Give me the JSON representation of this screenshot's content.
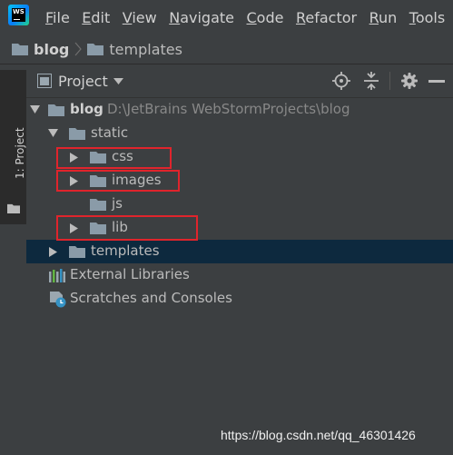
{
  "menu": {
    "items": [
      {
        "mnemonic": "F",
        "rest": "ile"
      },
      {
        "mnemonic": "E",
        "rest": "dit"
      },
      {
        "mnemonic": "V",
        "rest": "iew"
      },
      {
        "mnemonic": "N",
        "rest": "avigate"
      },
      {
        "mnemonic": "C",
        "rest": "ode"
      },
      {
        "mnemonic": "R",
        "rest": "efactor"
      },
      {
        "mnemonic": "R",
        "rest": "un"
      },
      {
        "mnemonic": "T",
        "rest": "ools"
      }
    ]
  },
  "breadcrumbs": [
    "blog",
    "templates"
  ],
  "tool_stripe": {
    "label": "1: Project"
  },
  "panel": {
    "view_label": "Project"
  },
  "tree": {
    "root": {
      "name": "blog",
      "path": "D:\\JetBrains WebStormProjects\\blog"
    },
    "static": "static",
    "css": "css",
    "images": "images",
    "js": "js",
    "lib": "lib",
    "templates": "templates",
    "external_libraries": "External Libraries",
    "scratches": "Scratches and Consoles"
  },
  "colors": {
    "background": "#3c3f41",
    "selection": "#0d293e",
    "folder": "#8a9ba8",
    "highlight_box": "#e0242c"
  },
  "watermark": "https://blog.csdn.net/qq_46301426"
}
